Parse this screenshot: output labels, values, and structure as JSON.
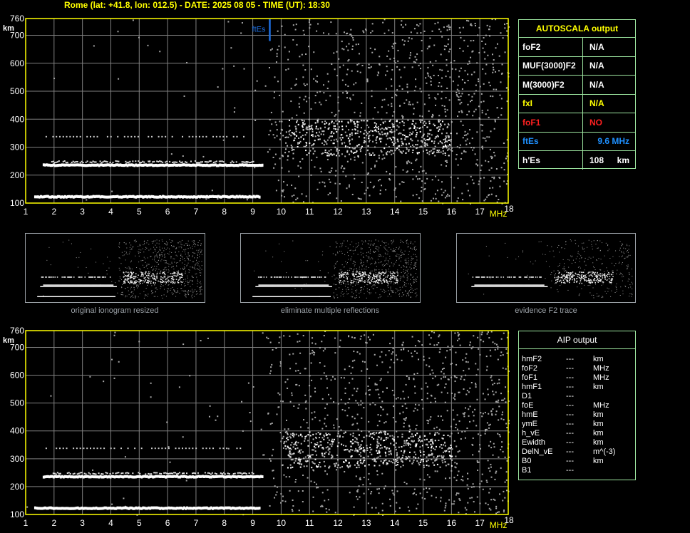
{
  "header": {
    "text": "Rome (lat: +41.8, lon: 012.5) - DATE: 2025 08 05 - TIME (UT): 18:30"
  },
  "chart_data": [
    {
      "type": "scatter",
      "name": "main-ionogram",
      "xlabel": "MHz",
      "ylabel": "km",
      "xlim": [
        1,
        18
      ],
      "ylim": [
        100,
        760
      ],
      "x_ticks": [
        "1",
        "2",
        "3",
        "4",
        "5",
        "6",
        "7",
        "8",
        "9",
        "10",
        "11",
        "12",
        "13",
        "14",
        "15",
        "16",
        "17",
        "18"
      ],
      "y_ticks": [
        "100",
        "200",
        "300",
        "400",
        "500",
        "600",
        "700",
        "760"
      ],
      "grid": true,
      "colors": {
        "axis": "#ffff00",
        "grid": "#808080",
        "trace": "#ffffff",
        "marker": "#1e6fe0"
      },
      "marker": {
        "label": "ftEs",
        "x": 9.6,
        "y_range": [
          700,
          760
        ]
      },
      "traces": [
        {
          "role": "Es-trace",
          "x_range": [
            1.3,
            9.2
          ],
          "height": 120,
          "intensity": "strong"
        },
        {
          "role": "F-trace",
          "x_range": [
            1.6,
            9.3
          ],
          "height": 233,
          "intensity": "strong"
        },
        {
          "role": "F-trace-upper",
          "x_range": [
            1.9,
            9.0
          ],
          "height": 250,
          "intensity": "medium"
        },
        {
          "role": "multiple-reflection",
          "x_range": [
            1.7,
            8.7
          ],
          "height": 340,
          "intensity": "weak"
        }
      ]
    },
    {
      "type": "scatter",
      "name": "aip-ionogram",
      "xlabel": "MHz",
      "ylabel": "km",
      "xlim": [
        1,
        18
      ],
      "ylim": [
        100,
        760
      ],
      "x_ticks": [
        "1",
        "2",
        "3",
        "4",
        "5",
        "6",
        "7",
        "8",
        "9",
        "10",
        "11",
        "12",
        "13",
        "14",
        "15",
        "16",
        "17",
        "18"
      ],
      "y_ticks": [
        "100",
        "200",
        "300",
        "400",
        "500",
        "600",
        "700",
        "760"
      ],
      "grid": true,
      "colors": {
        "axis": "#ffff00",
        "grid": "#808080",
        "trace": "#ffffff"
      },
      "traces": [
        {
          "role": "Es-trace",
          "x_range": [
            1.3,
            9.2
          ],
          "height": 120,
          "intensity": "strong"
        },
        {
          "role": "F-trace",
          "x_range": [
            1.6,
            9.3
          ],
          "height": 233,
          "intensity": "strong"
        },
        {
          "role": "F-trace-upper",
          "x_range": [
            1.9,
            9.0
          ],
          "height": 250,
          "intensity": "medium"
        },
        {
          "role": "multiple-reflection",
          "x_range": [
            1.7,
            8.7
          ],
          "height": 340,
          "intensity": "weak"
        }
      ]
    }
  ],
  "thumbnails": [
    {
      "caption": "original ionogram resized",
      "show_es": true
    },
    {
      "caption": "eliminate multiple reflections",
      "show_es": true
    },
    {
      "caption": "evidence F2 trace",
      "show_es": false
    }
  ],
  "autoscala": {
    "title": "AUTOSCALA output",
    "rows": [
      {
        "label": "foF2",
        "value": "N/A",
        "unit": "",
        "color": "#ffffff"
      },
      {
        "label": "MUF(3000)F2",
        "value": "N/A",
        "unit": "",
        "color": "#ffffff"
      },
      {
        "label": "M(3000)F2",
        "value": "N/A",
        "unit": "",
        "color": "#ffffff"
      },
      {
        "label": "fxI",
        "value": "N/A",
        "unit": "",
        "color": "#ffff00"
      },
      {
        "label": "foF1",
        "value": "NO",
        "unit": "",
        "color": "#ff2020"
      },
      {
        "label": "ftEs",
        "value": "9.6 MHz",
        "unit": "",
        "color": "#1e90ff"
      },
      {
        "label": "h'Es",
        "value": "108",
        "unit": "km",
        "color": "#ffffff"
      }
    ]
  },
  "aip": {
    "title": "AIP output",
    "rows": [
      {
        "label": "hmF2",
        "value": "---",
        "unit": "km"
      },
      {
        "label": "foF2",
        "value": "---",
        "unit": "MHz"
      },
      {
        "label": "foF1",
        "value": "---",
        "unit": "MHz"
      },
      {
        "label": "hmF1",
        "value": "---",
        "unit": "km"
      },
      {
        "label": "D1",
        "value": "---",
        "unit": ""
      },
      {
        "label": "foE",
        "value": "---",
        "unit": "MHz"
      },
      {
        "label": "hmE",
        "value": "---",
        "unit": "km"
      },
      {
        "label": "ymE",
        "value": "---",
        "unit": "km"
      },
      {
        "label": "h_vE",
        "value": "---",
        "unit": "km"
      },
      {
        "label": "Ewidth",
        "value": "---",
        "unit": "km"
      },
      {
        "label": "DelN_vE",
        "value": "---",
        "unit": "m^(-3)"
      },
      {
        "label": "B0",
        "value": "---",
        "unit": "km"
      },
      {
        "label": "B1",
        "value": "---",
        "unit": ""
      }
    ]
  }
}
